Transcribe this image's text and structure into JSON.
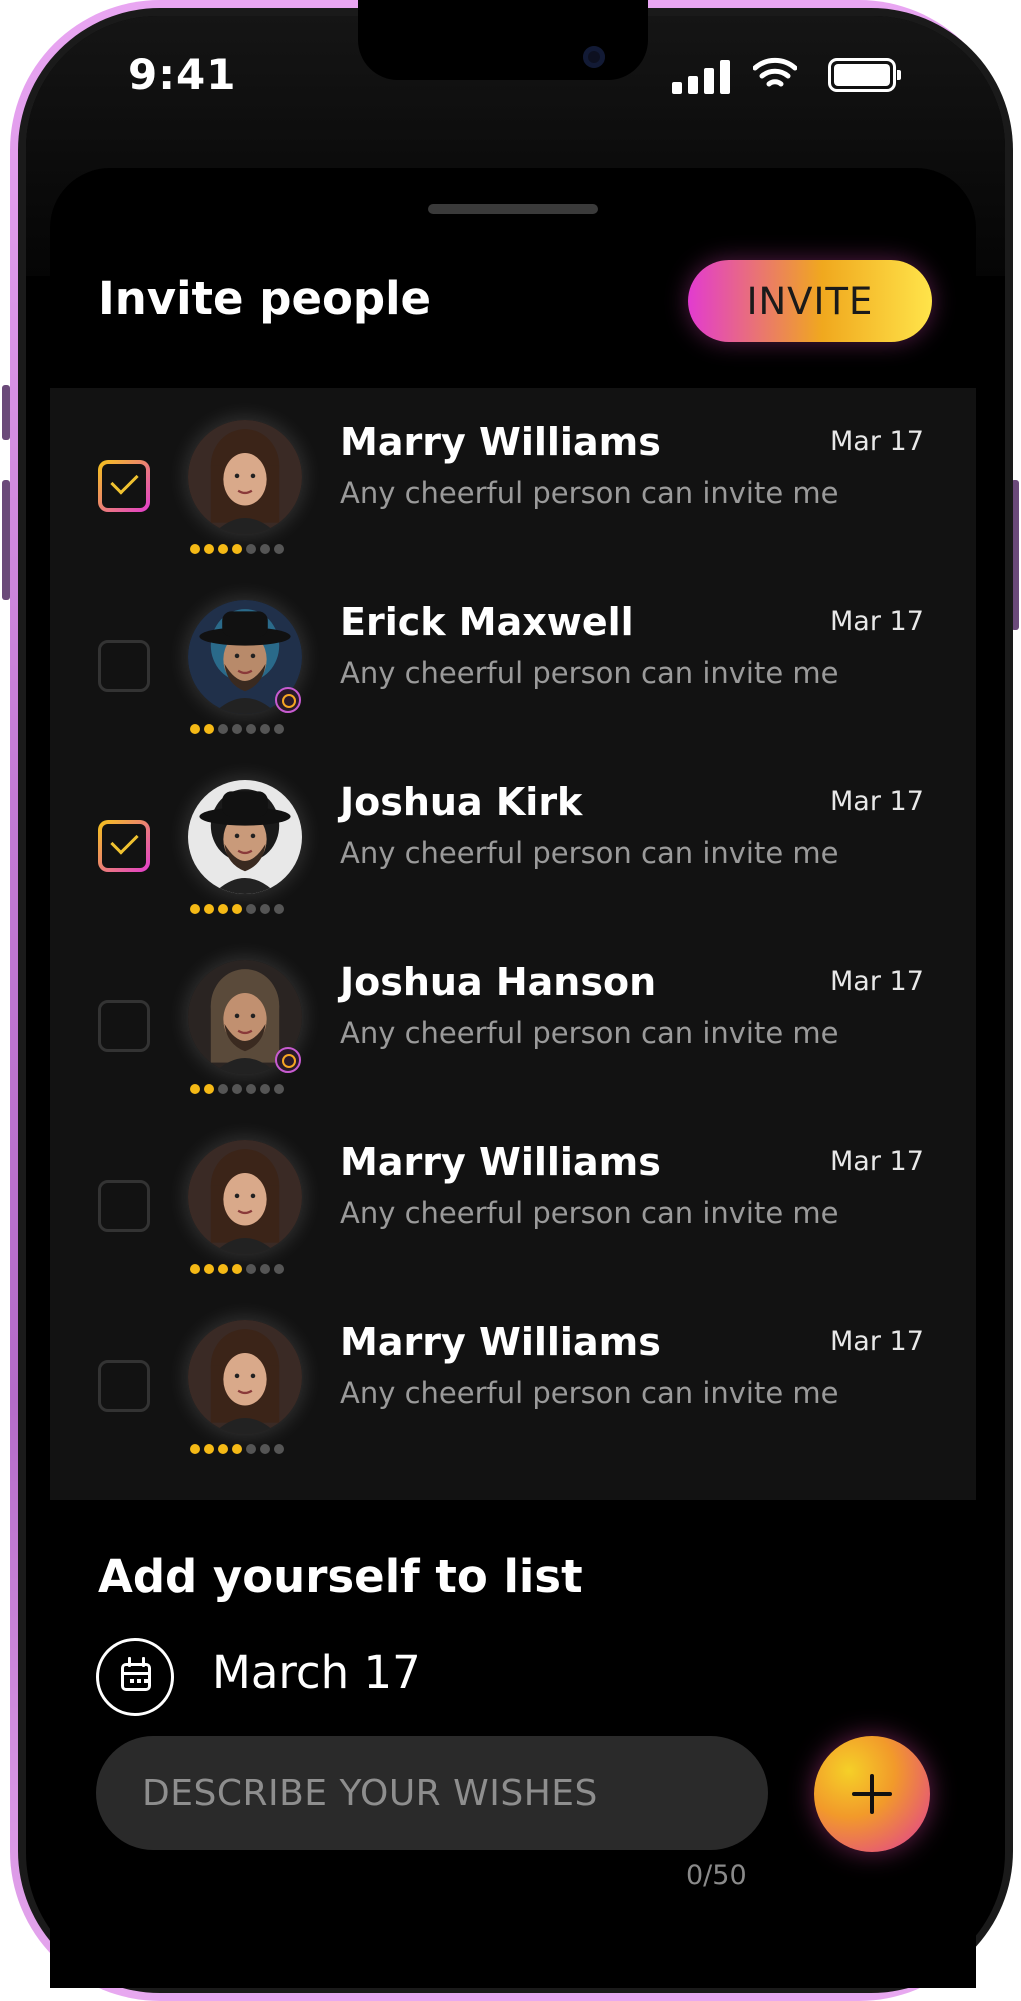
{
  "status": {
    "time": "9:41"
  },
  "header": {
    "title": "Invite people",
    "invite_label": "INVITE"
  },
  "contacts": [
    {
      "name": "Marry Williams",
      "date": "Mar 17",
      "message": "Any cheerful person can invite me",
      "checked": true,
      "rating": 4
    },
    {
      "name": "Erick Maxwell",
      "date": "Mar 17",
      "message": "Any cheerful person can invite me",
      "checked": false,
      "rating": 2
    },
    {
      "name": "Joshua Kirk",
      "date": "Mar 17",
      "message": "Any cheerful person can invite me",
      "checked": true,
      "rating": 4
    },
    {
      "name": "Joshua Hanson",
      "date": "Mar 17",
      "message": "Any cheerful person can invite me",
      "checked": false,
      "rating": 2
    },
    {
      "name": "Marry Williams",
      "date": "Mar 17",
      "message": "Any cheerful person can invite me",
      "checked": false,
      "rating": 4
    },
    {
      "name": "Marry Williams",
      "date": "Mar 17",
      "message": "Any cheerful person can invite me",
      "checked": false,
      "rating": 4
    }
  ],
  "add_section": {
    "title": "Add yourself to list",
    "date": "March  17",
    "wish_placeholder": "DESCRIBE YOUR WISHES",
    "counter": "0/50"
  },
  "icons": {
    "calendar": "calendar-icon",
    "add": "plus-icon",
    "check": "check-icon"
  },
  "colors": {
    "accent_pink": "#e23bd0",
    "accent_yellow": "#f5c518",
    "background": "#000000",
    "list_bg": "#121212"
  }
}
